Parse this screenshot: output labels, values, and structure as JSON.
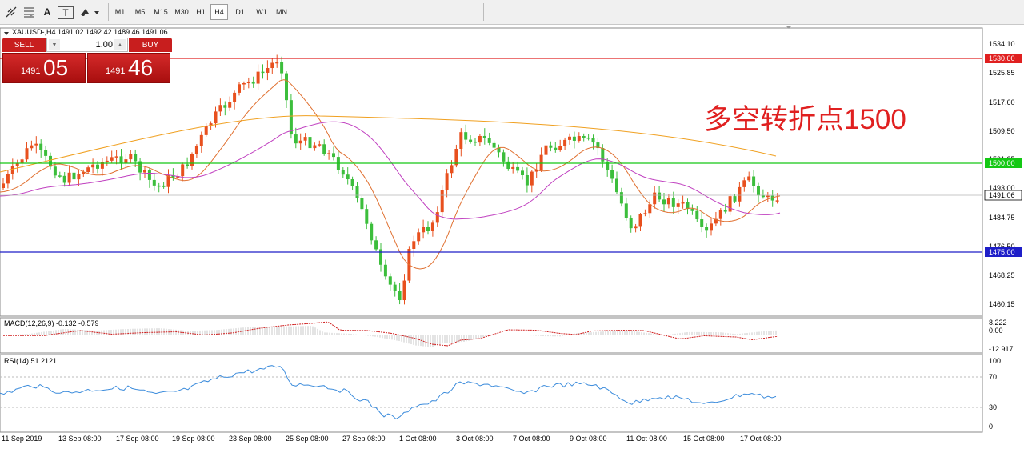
{
  "toolbar": {
    "drawing_tools": [
      "crosshair",
      "fibonacci",
      "text",
      "text-label",
      "shapes"
    ],
    "timeframes": [
      "M1",
      "M5",
      "M15",
      "M30",
      "H1",
      "H4",
      "D1",
      "W1",
      "MN"
    ],
    "active_timeframe": "H4",
    "text_tool_label": "A",
    "label_tool_label": "T"
  },
  "chart": {
    "header": "XAUUSD-,H4  1491.02 1492.42 1489.46 1491.06",
    "annotation": "多空转折点1500",
    "annotation_color": "#e02020",
    "price_axis": [
      "1534.10",
      "1525.85",
      "1517.60",
      "1509.50",
      "1501.25",
      "1493.00",
      "1484.75",
      "1476.50",
      "1468.25",
      "1460.15"
    ],
    "level_labels": [
      {
        "text": "1530.00",
        "color": "#e02020"
      },
      {
        "text": "1500.00",
        "color": "#14c814"
      },
      {
        "text": "1491.06",
        "color": "#000000"
      },
      {
        "text": "1475.00",
        "color": "#1e1ec8"
      }
    ],
    "time_axis": [
      "11 Sep 2019",
      "13 Sep 08:00",
      "17 Sep 08:00",
      "19 Sep 08:00",
      "23 Sep 08:00",
      "25 Sep 08:00",
      "27 Sep 08:00",
      "1 Oct 08:00",
      "3 Oct 08:00",
      "7 Oct 08:00",
      "9 Oct 08:00",
      "11 Oct 08:00",
      "15 Oct 08:00",
      "17 Oct 08:00"
    ]
  },
  "trade_panel": {
    "sell_label": "SELL",
    "buy_label": "BUY",
    "lot": "1.00",
    "sell_small": "1491",
    "sell_big": "05",
    "buy_small": "1491",
    "buy_big": "46"
  },
  "macd": {
    "label": "MACD(12,26,9) -0.132 -0.579",
    "axis": [
      "8.222",
      "0.00",
      "-12.917"
    ]
  },
  "rsi": {
    "label": "RSI(14) 51.2121",
    "axis": [
      "100",
      "70",
      "30",
      "0"
    ]
  }
}
